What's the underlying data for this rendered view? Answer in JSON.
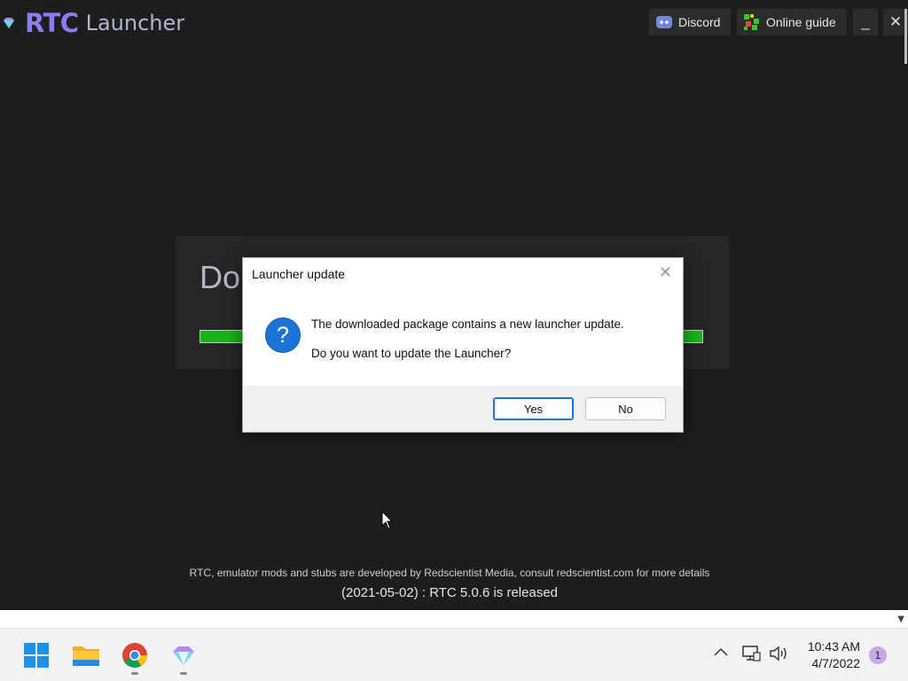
{
  "app": {
    "logo_rtc": "RTC",
    "logo_launcher": "Launcher",
    "discord_label": "Discord",
    "guide_label": "Online guide",
    "minimize_label": "_",
    "close_label": "✕",
    "panel_heading": "Do",
    "footer_note": "RTC, emulator mods and stubs are developed by Redscientist Media, consult redscientist.com for more details",
    "news": "(2021-05-02) : RTC 5.0.6 is released"
  },
  "dialog": {
    "title": "Launcher update",
    "message_line1": "The downloaded package contains a new launcher update.",
    "message_line2": "Do you want to update the Launcher?",
    "yes_label": "Yes",
    "no_label": "No",
    "close_glyph": "✕",
    "icon": "question-icon"
  },
  "taskbar": {
    "icons": [
      "windows-start-icon",
      "file-explorer-icon",
      "chrome-icon",
      "rtc-launcher-icon"
    ],
    "time": "10:43 AM",
    "date": "4/7/2022",
    "notification_count": "1"
  },
  "colors": {
    "accent": "#8b7cf0",
    "progress": "#17b31a",
    "dialog_question": "#1b74d6"
  }
}
